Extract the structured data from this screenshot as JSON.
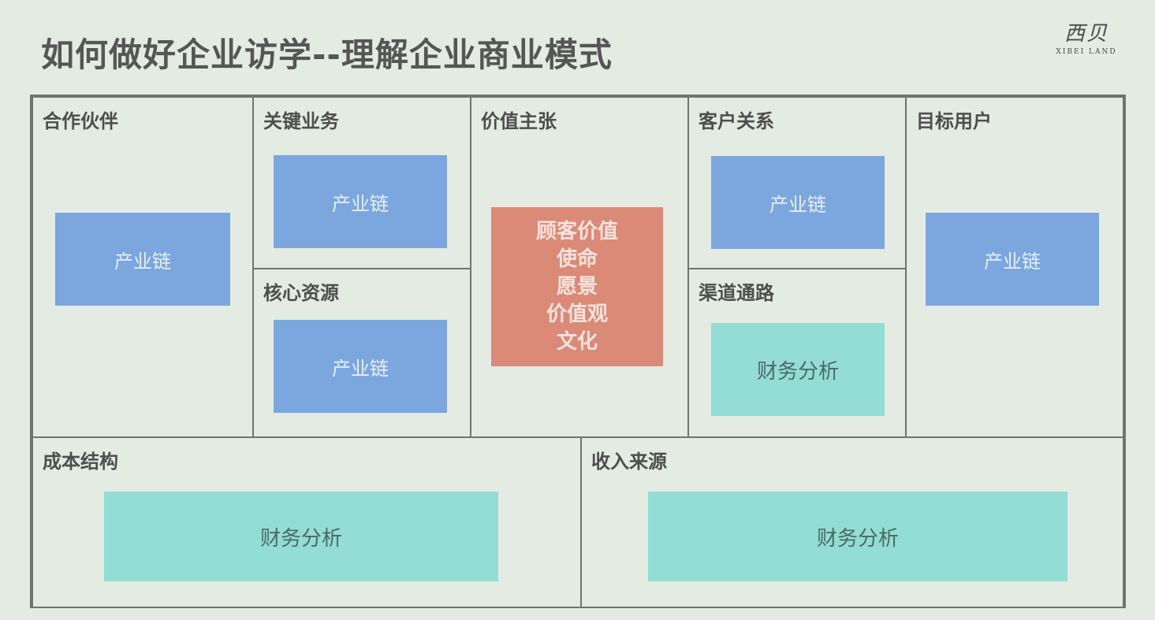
{
  "title": "如何做好企业访学--理解企业商业模式",
  "logo": {
    "mark": "西贝",
    "sub": "XIBEI LAND"
  },
  "canvas": {
    "partners": {
      "label": "合作伙伴",
      "box": "产业链"
    },
    "key_activities": {
      "label": "关键业务",
      "box": "产业链"
    },
    "key_resources": {
      "label": "核心资源",
      "box": "产业链"
    },
    "value_proposition": {
      "label": "价值主张",
      "lines": [
        "顾客价值",
        "使命",
        "愿景",
        "价值观",
        "文化"
      ]
    },
    "customer_relationships": {
      "label": "客户关系",
      "box": "产业链"
    },
    "channels": {
      "label": "渠道通路",
      "box": "财务分析"
    },
    "customer_segments": {
      "label": "目标用户",
      "box": "产业链"
    },
    "cost_structure": {
      "label": "成本结构",
      "box": "财务分析"
    },
    "revenue_streams": {
      "label": "收入来源",
      "box": "财务分析"
    }
  },
  "colors": {
    "background": "#e3ebe3",
    "border": "#6e756e",
    "blue_box": "#7ba7de",
    "teal_box": "#93ddd4",
    "salmon_box": "#db8a78"
  }
}
